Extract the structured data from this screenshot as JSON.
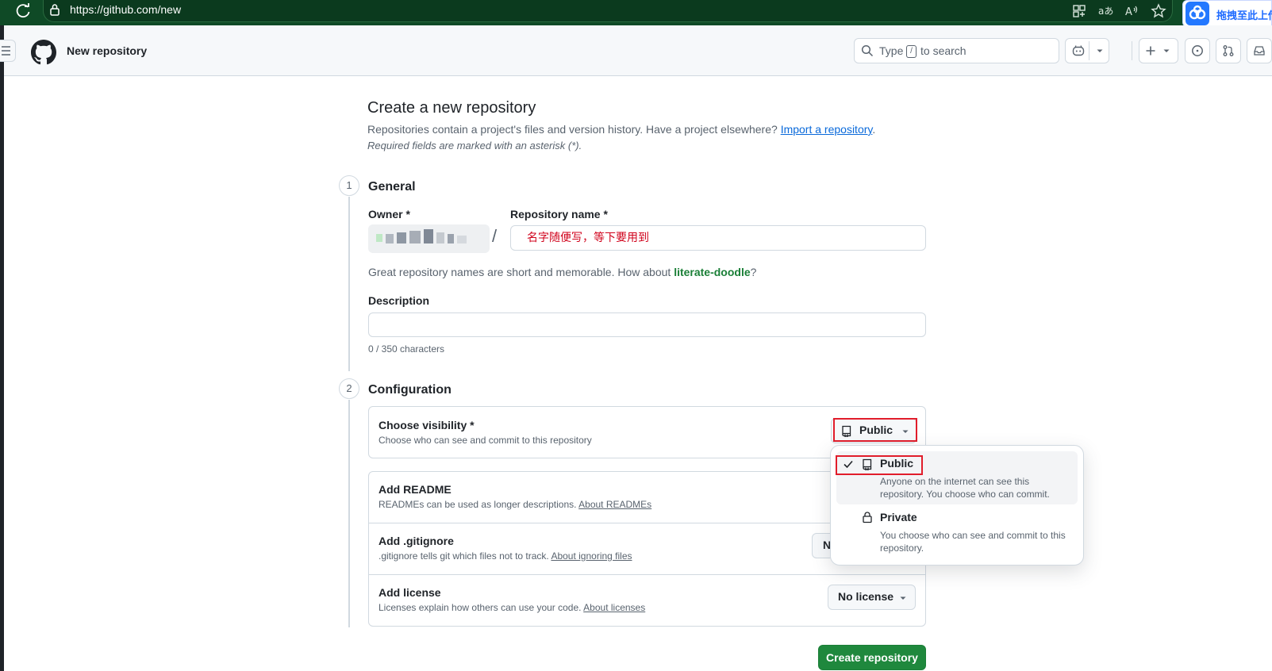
{
  "browser": {
    "url": "https://github.com/new",
    "extension_label": "拖拽至此上传"
  },
  "header": {
    "page_title": "New repository",
    "search_prefix": "Type",
    "search_key": "/",
    "search_suffix": "to search"
  },
  "main": {
    "title": "Create a new repository",
    "intro_text": "Repositories contain a project's files and version history. Have a project elsewhere?",
    "import_link": "Import a repository",
    "intro_end": ".",
    "required_note": "Required fields are marked with an asterisk (*).",
    "sections": [
      {
        "number": "1",
        "title": "General"
      },
      {
        "number": "2",
        "title": "Configuration"
      }
    ],
    "owner_label": "Owner *",
    "owner_separator": "/",
    "repo_name_label": "Repository name *",
    "repo_name_value": "名字随便写，等下要用到",
    "name_hint_pre": "Great repository names are short and memorable. How about",
    "name_hint_suggestion": "literate-doodle",
    "name_hint_end": "?",
    "description_label": "Description",
    "description_value": "",
    "description_counter": "0 / 350 characters"
  },
  "config": {
    "visibility_title": "Choose visibility *",
    "visibility_desc": "Choose who can see and commit to this repository",
    "visibility_selected": "Public",
    "readme_title": "Add README",
    "readme_desc": "READMEs can be used as longer descriptions.",
    "readme_link": "About READMEs",
    "gitignore_title": "Add .gitignore",
    "gitignore_desc": ".gitignore tells git which files not to track.",
    "gitignore_link": "About ignoring files",
    "gitignore_button_partial": "N",
    "license_title": "Add license",
    "license_desc": "Licenses explain how others can use your code.",
    "license_link": "About licenses",
    "license_button": "No license"
  },
  "visibility_menu": {
    "options": [
      {
        "label": "Public",
        "desc": "Anyone on the internet can see this repository. You choose who can commit.",
        "selected": true,
        "icon": "repo-icon"
      },
      {
        "label": "Private",
        "desc": "You choose who can see and commit to this repository.",
        "selected": false,
        "icon": "lock-icon"
      }
    ]
  },
  "actions": {
    "create_label": "Create repository"
  },
  "colors": {
    "accent_green": "#1f883d",
    "link_blue": "#0969da",
    "annotation_red": "#e11d2b",
    "browser_green": "#0f4a26"
  }
}
